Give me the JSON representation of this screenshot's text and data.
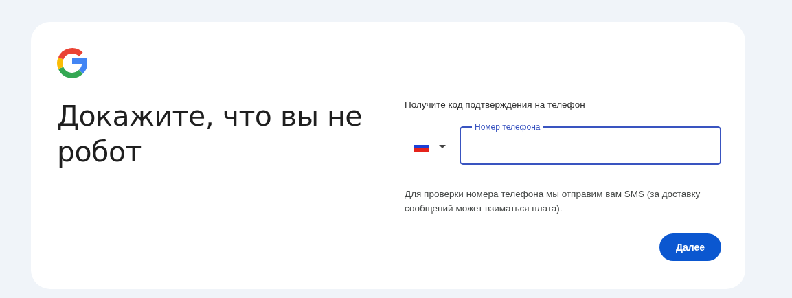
{
  "heading": "Докажите, что вы не робот",
  "prompt": "Получите код подтверждения на телефон",
  "phone_field": {
    "label": "Номер телефона",
    "focused": true
  },
  "helper_text": "Для проверки номера телефона мы отправим вам SMS (за доставку сообщений может взиматься плата).",
  "buttons": [
    "Далее"
  ]
}
